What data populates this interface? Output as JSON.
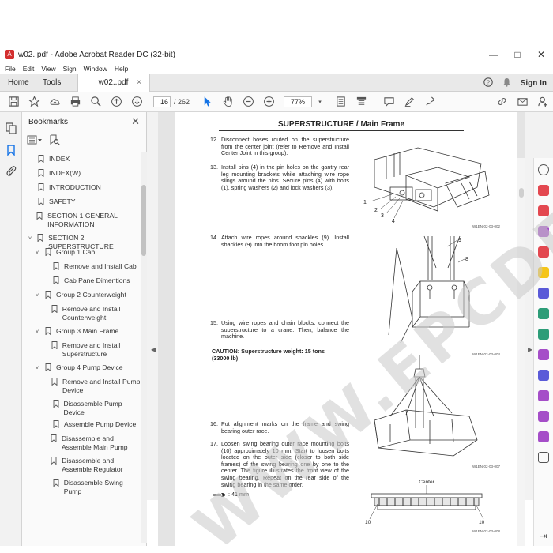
{
  "window": {
    "title": "w02..pdf - Adobe Acrobat Reader DC (32-bit)",
    "minimize": "—",
    "maximize": "□",
    "close": "✕"
  },
  "menu": [
    "File",
    "Edit",
    "View",
    "Sign",
    "Window",
    "Help"
  ],
  "tabs": {
    "home": "Home",
    "tools": "Tools",
    "document": "w02..pdf",
    "doc_close": "×",
    "sign_in": "Sign In"
  },
  "toolbar": {
    "page_current": "16",
    "page_total": "/ 262",
    "zoom": "77%"
  },
  "bookmarks": {
    "header": "Bookmarks",
    "items": [
      {
        "label": "INDEX",
        "level": 0,
        "chev": ""
      },
      {
        "label": "INDEX(W)",
        "level": 0,
        "chev": ""
      },
      {
        "label": "INTRODUCTION",
        "level": 0,
        "chev": ""
      },
      {
        "label": "SAFETY",
        "level": 0,
        "chev": ""
      },
      {
        "label": "SECTION 1 GENERAL INFORMATION",
        "level": 0,
        "chev": ""
      },
      {
        "label": "SECTION 2 SUPERSTRUCTURE",
        "level": 0,
        "chev": "v"
      },
      {
        "label": "Group 1 Cab",
        "level": 1,
        "chev": "v"
      },
      {
        "label": "Remove and Install Cab",
        "level": 2,
        "chev": ""
      },
      {
        "label": "Cab Pane Dimentions",
        "level": 2,
        "chev": ""
      },
      {
        "label": "Group 2 Counterweight",
        "level": 1,
        "chev": "v"
      },
      {
        "label": "Remove and Install Counterweight",
        "level": 2,
        "chev": ""
      },
      {
        "label": "Group 3 Main Frame",
        "level": 1,
        "chev": "v"
      },
      {
        "label": "Remove and Install Superstructure",
        "level": 2,
        "chev": ""
      },
      {
        "label": "Group 4 Pump Device",
        "level": 1,
        "chev": "v"
      },
      {
        "label": "Remove and Install Pump Device",
        "level": 2,
        "chev": ""
      },
      {
        "label": "Disassemble Pump Device",
        "level": 2,
        "chev": ""
      },
      {
        "label": "Assemble Pump Device",
        "level": 2,
        "chev": ""
      },
      {
        "label": "Disassemble and Assemble Main Pump",
        "level": 2,
        "chev": ""
      },
      {
        "label": "Disassemble and Assemble Regulator",
        "level": 2,
        "chev": ""
      },
      {
        "label": "Disassemble Swing Pump",
        "level": 2,
        "chev": ""
      }
    ]
  },
  "document": {
    "title": "SUPERSTRUCTURE / Main Frame",
    "steps": [
      {
        "num": "12.",
        "text": "Disconnect hoses routed on the superstructure from the center joint (refer to Remove and Install Center Joint in this group)."
      },
      {
        "num": "13.",
        "text": "Install pins (4) in the pin holes on the gantry rear leg mounting brackets while attaching wire rope slings around the pins. Secure pins (4) with bolts (1), spring washers (2) and lock washers (3)."
      },
      {
        "num": "14.",
        "text": "Attach wire ropes around shackles (9). Install shackles (9) into the boom foot pin holes."
      },
      {
        "num": "15.",
        "text": "Using wire ropes and chain blocks, connect the superstructure to a crane. Then, balance the machine."
      },
      {
        "num": "16.",
        "text": "Put alignment marks on the frame and swing bearing outer race."
      },
      {
        "num": "17.",
        "text": "Loosen swing bearing outer race mounting bolts (10) approximately 10 mm. Start to loosen bolts located on the outer side (closer to both side frames) of the swing bearing one by one to the center. The figure illustrates the front view of the swing bearing. Repeat on the rear side of the swing bearing in the same order."
      }
    ],
    "caution": "CAUTION:  Superstructure weight: 15 tons (33000 lb)",
    "wrench": ": 41 mm",
    "fig1_labels": [
      "1",
      "2",
      "3",
      "4"
    ],
    "fig1_ref": "W1EN-02-03-002",
    "fig2_labels": [
      "9",
      "8"
    ],
    "fig2_ref": "W1EN-02-03-004",
    "fig3_ref": "W1EN-02-03-007",
    "fig4_center": "Center",
    "fig4_labels": [
      "10",
      "10"
    ],
    "fig4_ref": "W1EN-02-03-008"
  },
  "watermark": "WWW.EPCDEPO.COM"
}
